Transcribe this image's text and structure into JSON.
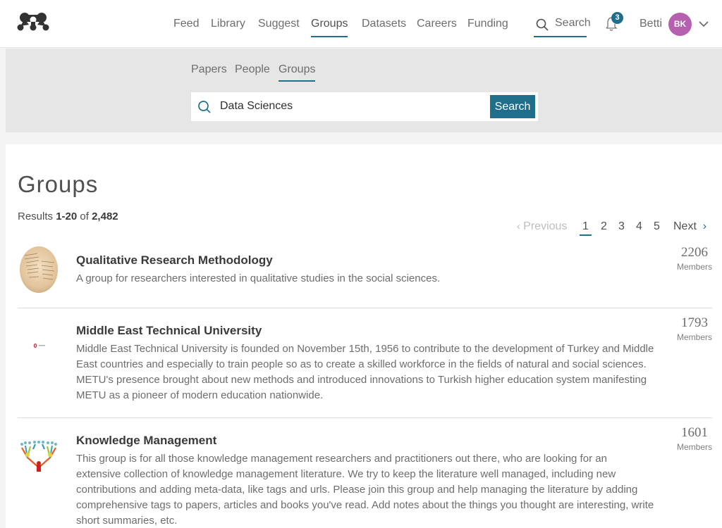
{
  "topnav": {
    "logo": "mendeley-logo-icon",
    "items": [
      {
        "label": "Feed",
        "active": false
      },
      {
        "label": "Library",
        "active": false
      },
      {
        "label": "Suggest",
        "active": false
      },
      {
        "label": "Groups",
        "active": true
      },
      {
        "label": "Datasets",
        "active": false
      },
      {
        "label": "Careers",
        "active": false
      },
      {
        "label": "Funding",
        "active": false
      }
    ],
    "search_label": "Search",
    "notifications_count": "3",
    "user_name": "Betti",
    "avatar_initials": "BK",
    "avatar_color": "#b660b0",
    "accent_color": "#1f6f8b"
  },
  "search": {
    "tabs": [
      {
        "label": "Papers",
        "active": false
      },
      {
        "label": "People",
        "active": false
      },
      {
        "label": "Groups",
        "active": true
      }
    ],
    "query": "Data Sciences",
    "button_label": "Search"
  },
  "results": {
    "title": "Groups",
    "prefix": "Results",
    "range": "1-20",
    "of_label": "of",
    "total": "2,482"
  },
  "pagination": {
    "previous_label": "Previous",
    "next_label": "Next",
    "pages": [
      "1",
      "2",
      "3",
      "4",
      "5"
    ],
    "current": "1"
  },
  "groups": [
    {
      "name": "Qualitative Research Methodology",
      "description": "A group for researchers interested in qualitative studies in the social sciences.",
      "members": "2206",
      "members_label": "Members",
      "thumbnail": "old-manuscript-image"
    },
    {
      "name": "Middle East Technical University",
      "description": "Middle East Technical University is founded on November 15th, 1956 to contribute to the development of Turkey and Middle East countries and especially to train people so as to create a skilled workforce in the fields of natural and social sciences. METU's presence brought about new methods and introduced innovations to Turkish higher education system manifesting METU as a pioneer of modern education nationwide.",
      "members": "1793",
      "members_label": "Members",
      "thumbnail": "metu-logo-image"
    },
    {
      "name": "Knowledge Management",
      "description": "This group is for all those knowledge management researchers and practitioners out there, who are looking for an extensive collection of knowledge management literature. We try to keep the literature well managed, including new contributions and adding meta-data, like tags and urls. Please join this group and help managing the literature by adding comprehensive tags to papers, articles and books you've read. Add notes about the things you thought are interesting, write short summaries, etc.",
      "members": "1601",
      "members_label": "Members",
      "thumbnail": "people-network-image"
    }
  ]
}
